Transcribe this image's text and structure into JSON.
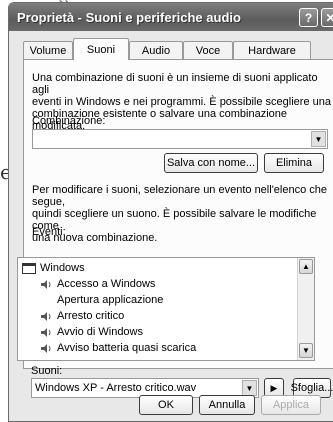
{
  "window": {
    "title": "Proprietà - Suoni e periferiche audio",
    "help_label": "?",
    "close_label": "✕"
  },
  "tabs": [
    "Volume",
    "Suoni",
    "Audio",
    "Voce",
    "Hardware"
  ],
  "suoni": {
    "intro_lines": [
      "Una combinazione di suoni è un insieme di suoni applicato agli",
      "eventi in Windows e nei programmi. È possibile scegliere una",
      "combinazione esistente o salvare una combinazione modificata."
    ],
    "scheme_label": "Combinazione:",
    "scheme_value": "",
    "save_as_label": "Salva con nome...",
    "delete_label": "Elimina",
    "help_lines": [
      "Per modificare i suoni, selezionare un evento nell'elenco che segue,",
      "quindi scegliere un suono. È possibile salvare le modifiche come",
      "una nuova combinazione."
    ],
    "events_label": "Eventi:",
    "events": [
      {
        "label": "Windows",
        "kind": "group",
        "sound": false
      },
      {
        "label": "Accesso a Windows",
        "kind": "event",
        "sound": true
      },
      {
        "label": "Apertura applicazione",
        "kind": "event",
        "sound": false
      },
      {
        "label": "Arresto critico",
        "kind": "event",
        "sound": true
      },
      {
        "label": "Avvio di Windows",
        "kind": "event",
        "sound": true
      },
      {
        "label": "Avviso batteria quasi scarica",
        "kind": "event",
        "sound": true
      }
    ],
    "sounds_label": "Suoni:",
    "sound_value": "Windows XP - Arresto critico.wav",
    "play_label": "▶",
    "browse_label": "Sfoglia..."
  },
  "footer": {
    "ok_label": "OK",
    "cancel_label": "Annulla",
    "apply_label": "Applica"
  }
}
